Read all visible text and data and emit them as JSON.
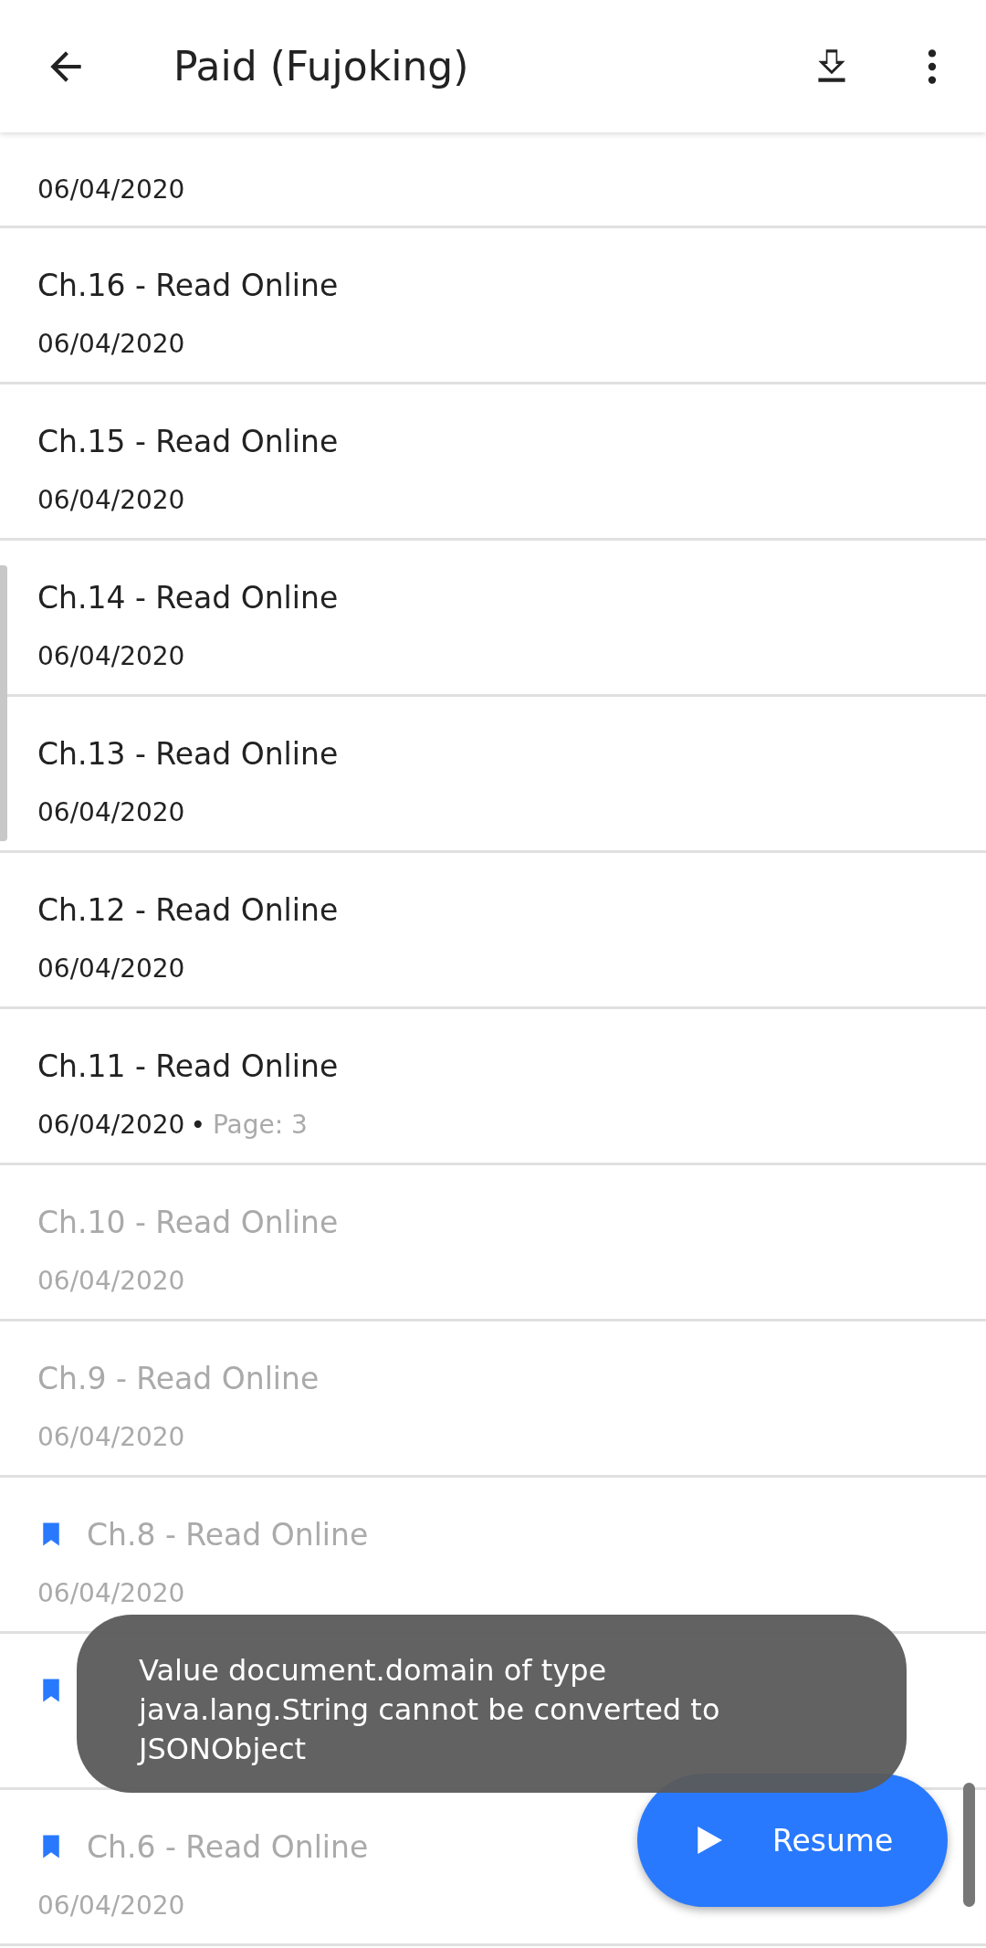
{
  "toolbar": {
    "title": "Paid (Fujoking)"
  },
  "chapters": [
    {
      "date": "06/04/2020",
      "read": false,
      "bookmarked": false
    },
    {
      "title": "Ch.16 - Read Online",
      "date": "06/04/2020",
      "read": false,
      "bookmarked": false
    },
    {
      "title": "Ch.15 - Read Online",
      "date": "06/04/2020",
      "read": false,
      "bookmarked": false
    },
    {
      "title": "Ch.14 - Read Online",
      "date": "06/04/2020",
      "read": false,
      "bookmarked": false
    },
    {
      "title": "Ch.13 - Read Online",
      "date": "06/04/2020",
      "read": false,
      "bookmarked": false
    },
    {
      "title": "Ch.12 - Read Online",
      "date": "06/04/2020",
      "read": false,
      "bookmarked": false
    },
    {
      "title": "Ch.11 - Read Online",
      "date": "06/04/2020",
      "separator": "•",
      "page": "Page: 3",
      "read": false,
      "bookmarked": false
    },
    {
      "title": "Ch.10 - Read Online",
      "date": "06/04/2020",
      "read": true,
      "bookmarked": false
    },
    {
      "title": "Ch.9 - Read Online",
      "date": "06/04/2020",
      "read": true,
      "bookmarked": false
    },
    {
      "title": "Ch.8 - Read Online",
      "date": "06/04/2020",
      "read": true,
      "bookmarked": true
    },
    {
      "bookmarked": true
    },
    {
      "title": "Ch.6 - Read Online",
      "date": "06/04/2020",
      "read": true,
      "bookmarked": true
    }
  ],
  "toast": {
    "message": "Value document.domain of type java.lang.String cannot be converted to JSONObject"
  },
  "fab": {
    "label": "Resume"
  }
}
